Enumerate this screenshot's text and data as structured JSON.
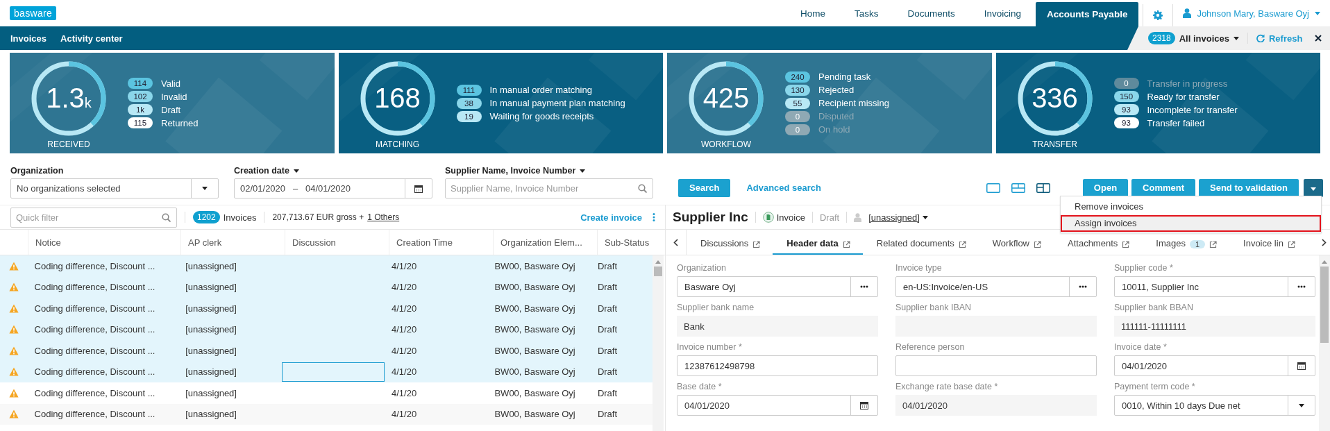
{
  "header": {
    "logo": "basware",
    "nav": [
      {
        "label": "Home",
        "selected": false
      },
      {
        "label": "Tasks",
        "selected": false
      },
      {
        "label": "Documents",
        "selected": false
      },
      {
        "label": "Invoicing",
        "selected": false
      },
      {
        "label": "Accounts Payable",
        "selected": true
      }
    ],
    "user": "Johnson Mary, Basware Oyj"
  },
  "subnav": {
    "links": [
      {
        "label": "Invoices"
      },
      {
        "label": "Activity center"
      }
    ],
    "count": "2318",
    "view": "All invoices",
    "refresh": "Refresh"
  },
  "cards": [
    {
      "title": "RECEIVED",
      "total": "1.3",
      "unit": "k",
      "items": [
        {
          "count": "114",
          "label": "Valid",
          "color": "#5bc4e0",
          "disabled": false
        },
        {
          "count": "102",
          "label": "Invalid",
          "color": "#8ad6ea",
          "disabled": false
        },
        {
          "count": "1k",
          "label": "Draft",
          "color": "#b8e8f5",
          "disabled": false
        },
        {
          "count": "115",
          "label": "Returned",
          "color": "#ffffff",
          "disabled": false
        }
      ]
    },
    {
      "title": "MATCHING",
      "total": "168",
      "items": [
        {
          "count": "111",
          "label": "In manual order matching",
          "color": "#5bc4e0",
          "disabled": false
        },
        {
          "count": "38",
          "label": "In manual payment plan matching",
          "color": "#8ad6ea",
          "disabled": false
        },
        {
          "count": "19",
          "label": "Waiting for goods receipts",
          "color": "#b8e8f5",
          "disabled": false
        }
      ]
    },
    {
      "title": "WORKFLOW",
      "total": "425",
      "items": [
        {
          "count": "240",
          "label": "Pending task",
          "color": "#5bc4e0",
          "disabled": false
        },
        {
          "count": "130",
          "label": "Rejected",
          "color": "#8ad6ea",
          "disabled": false
        },
        {
          "count": "55",
          "label": "Recipient missing",
          "color": "#b8e8f5",
          "disabled": false
        },
        {
          "count": "0",
          "label": "Disputed",
          "color": "#8fa9b4",
          "disabled": true
        },
        {
          "count": "0",
          "label": "On hold",
          "color": "#8fa9b4",
          "disabled": true
        }
      ]
    },
    {
      "title": "TRANSFER",
      "total": "336",
      "items": [
        {
          "count": "0",
          "label": "Transfer in progress",
          "color": "#5f8a9c",
          "disabled": true
        },
        {
          "count": "150",
          "label": "Ready for transfer",
          "color": "#8ad6ea",
          "disabled": false
        },
        {
          "count": "93",
          "label": "Incomplete for transfer",
          "color": "#b8e8f5",
          "disabled": false
        },
        {
          "count": "93",
          "label": "Transfer failed",
          "color": "#ffffff",
          "disabled": false
        }
      ]
    }
  ],
  "filters": [
    {
      "label": "Organization",
      "kind": "select",
      "value": "No organizations selected"
    },
    {
      "label": "Creation date",
      "kind": "daterange",
      "from": "02/01/2020",
      "separator": "–",
      "to": "04/01/2020"
    },
    {
      "label": "Supplier Name, Invoice Number",
      "kind": "search",
      "placeholder": "Supplier Name, Invoice Number"
    }
  ],
  "search_button": "Search",
  "advanced_search": "Advanced search",
  "view_modes": [
    {
      "kind": "single",
      "selected": false
    },
    {
      "kind": "rows",
      "selected": false
    },
    {
      "kind": "columns",
      "selected": true
    }
  ],
  "actions": [
    "Open",
    "Comment",
    "Send to validation"
  ],
  "list": {
    "quick_filter_placeholder": "Quick filter",
    "count": "1202",
    "count_label": "Invoices",
    "total": "207,713.67 EUR gross +",
    "others": "1 Others",
    "create": "Create invoice",
    "columns": [
      "Notice",
      "AP clerk",
      "Discussion",
      "Creation Time",
      "Organization Elem...",
      "Sub-Status"
    ],
    "rows": [
      {
        "warning": true,
        "notice": "Coding difference, Discount ...",
        "clerk": "[unassigned]",
        "time": "4/1/20",
        "org": "BW00, Basware Oyj",
        "status": "Draft",
        "selected": true,
        "discussion_focused": false
      },
      {
        "warning": true,
        "notice": "Coding difference, Discount ...",
        "clerk": "[unassigned]",
        "time": "4/1/20",
        "org": "BW00, Basware Oyj",
        "status": "Draft",
        "selected": true,
        "discussion_focused": false
      },
      {
        "warning": true,
        "notice": "Coding difference, Discount ...",
        "clerk": "[unassigned]",
        "time": "4/1/20",
        "org": "BW00, Basware Oyj",
        "status": "Draft",
        "selected": true,
        "discussion_focused": false
      },
      {
        "warning": true,
        "notice": "Coding difference, Discount ...",
        "clerk": "[unassigned]",
        "time": "4/1/20",
        "org": "BW00, Basware Oyj",
        "status": "Draft",
        "selected": true,
        "discussion_focused": false
      },
      {
        "warning": true,
        "notice": "Coding difference, Discount ...",
        "clerk": "[unassigned]",
        "time": "4/1/20",
        "org": "BW00, Basware Oyj",
        "status": "Draft",
        "selected": true,
        "discussion_focused": false
      },
      {
        "warning": true,
        "notice": "Coding difference, Discount ...",
        "clerk": "[unassigned]",
        "time": "4/1/20",
        "org": "BW00, Basware Oyj",
        "status": "Draft",
        "selected": true,
        "discussion_focused": true
      },
      {
        "warning": true,
        "notice": "Coding difference, Discount ...",
        "clerk": "[unassigned]",
        "time": "4/1/20",
        "org": "BW00, Basware Oyj",
        "status": "Draft",
        "selected": false,
        "discussion_focused": false
      },
      {
        "warning": true,
        "notice": "Coding difference, Discount ...",
        "clerk": "[unassigned]",
        "time": "4/1/20",
        "org": "BW00, Basware Oyj",
        "status": "Draft",
        "selected": false,
        "discussion_focused": false
      }
    ]
  },
  "detail": {
    "supplier": "Supplier Inc",
    "type": "Invoice",
    "status": "Draft",
    "assignee": "[unassigned]",
    "tabs": [
      {
        "label": "Discussions",
        "selected": false
      },
      {
        "label": "Header data",
        "selected": true
      },
      {
        "label": "Related documents",
        "selected": false
      },
      {
        "label": "Workflow",
        "selected": false
      },
      {
        "label": "Attachments",
        "selected": false
      },
      {
        "label": "Images",
        "selected": false,
        "badge": "1"
      },
      {
        "label": "Invoice lin",
        "selected": false
      }
    ],
    "fields": [
      {
        "label": "Organization",
        "kind": "lookup",
        "value": "Basware Oyj"
      },
      {
        "label": "Invoice type",
        "kind": "lookup",
        "value": "en-US:Invoice/en-US"
      },
      {
        "label": "Supplier code *",
        "kind": "lookup",
        "value": "10011, Supplier Inc"
      },
      {
        "label": "Supplier bank name",
        "kind": "readonly",
        "value": "Bank"
      },
      {
        "label": "Supplier bank IBAN",
        "kind": "readonly"
      },
      {
        "label": "Supplier bank BBAN",
        "kind": "readonly",
        "value": "111111-11111111"
      },
      {
        "label": "Invoice number *",
        "kind": "text",
        "value": "12387612498798"
      },
      {
        "label": "Reference person",
        "kind": "text"
      },
      {
        "label": "Invoice date *",
        "kind": "date",
        "value": "04/01/2020"
      },
      {
        "label": "Base date *",
        "kind": "date",
        "value": "04/01/2020"
      },
      {
        "label": "Exchange rate base date *",
        "kind": "readonly",
        "value": "04/01/2020"
      },
      {
        "label": "Payment term code *",
        "kind": "select",
        "value": "0010, Within 10 days Due net"
      }
    ]
  },
  "menu": {
    "items": [
      {
        "label": "Remove invoices",
        "highlighted": false
      },
      {
        "label": "Assign invoices",
        "highlighted": true
      }
    ]
  }
}
